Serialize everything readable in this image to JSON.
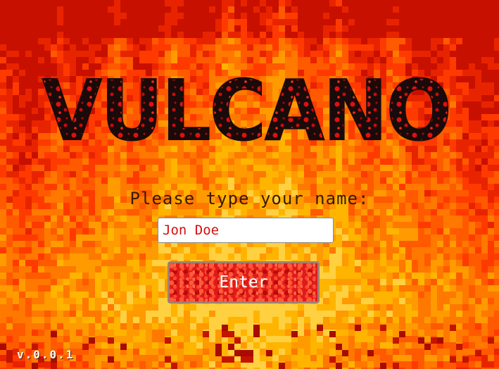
{
  "logo": {
    "text": "VULCANO"
  },
  "prompt": {
    "label": "Please type your name:"
  },
  "name_input": {
    "value": "Jon Doe"
  },
  "enter_button": {
    "label": "Enter"
  },
  "version": {
    "text": "v.0.0.1"
  },
  "colors": {
    "fire_red": "#ff2a00",
    "fire_orange": "#ff8a00",
    "fire_yellow": "#ffb000",
    "ember_dark": "#d41a00",
    "input_text": "#d41010",
    "prompt_text": "#3a1a00",
    "logo_fill": "#1a0a0a",
    "logo_spots": "#e01010"
  }
}
